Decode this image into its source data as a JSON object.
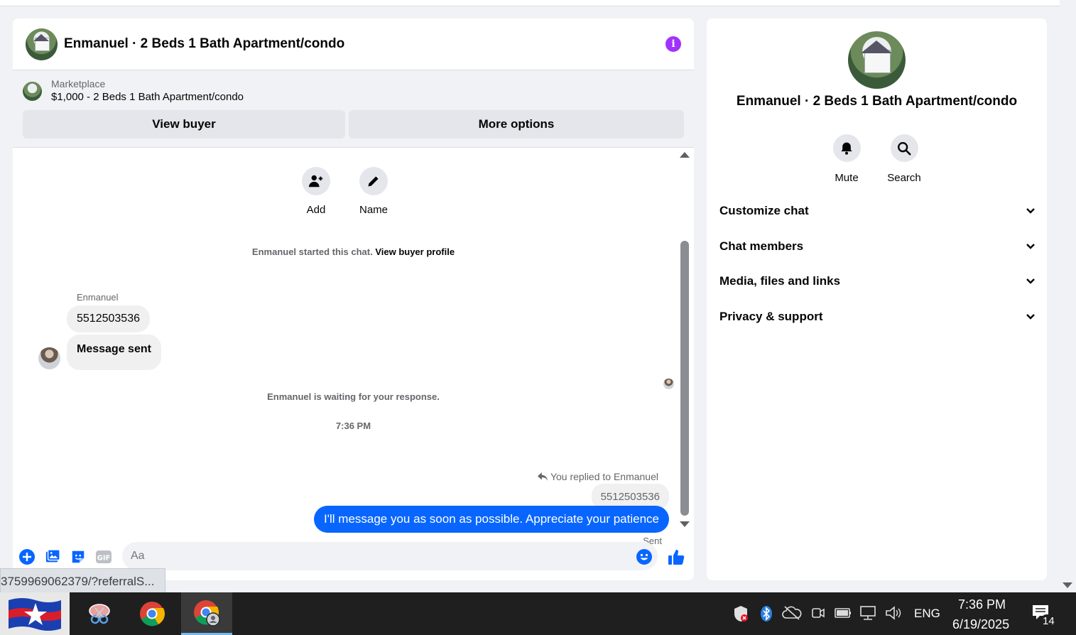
{
  "chat": {
    "header_title": "Enmanuel · 2 Beds 1 Bath Apartment/condo",
    "marketplace_label": "Marketplace",
    "listing": "$1,000 - 2 Beds 1 Bath Apartment/condo",
    "view_buyer": "View buyer",
    "more_options": "More options",
    "actions": [
      {
        "label": "Add",
        "icon": "add-person-icon"
      },
      {
        "label": "Name",
        "icon": "pencil-icon"
      }
    ],
    "started_text": "Enmanuel started this chat.",
    "view_buyer_profile": "View buyer profile",
    "sender": "Enmanuel",
    "incoming": [
      "5512503536",
      "Message sent"
    ],
    "waiting_text": "Enmanuel is waiting for your response.",
    "time": "7:36 PM",
    "replied_to": "You replied to Enmanuel",
    "quoted": "5512503536",
    "outgoing": "I'll message you as soon as possible. Appreciate your patience",
    "sent_status": "Sent",
    "composer_placeholder": "Aa"
  },
  "info_panel": {
    "title": "Enmanuel · 2 Beds 1 Bath Apartment/condo",
    "actions": [
      {
        "label": "Mute",
        "icon": "bell-icon"
      },
      {
        "label": "Search",
        "icon": "search-icon"
      }
    ],
    "sections": [
      "Customize chat",
      "Chat members",
      "Media, files and links",
      "Privacy & support"
    ]
  },
  "status_url": "3759969062379/?referralS...",
  "taskbar": {
    "language": "ENG",
    "time": "7:36 PM",
    "date": "6/19/2025",
    "notifications": "14"
  },
  "colors": {
    "accent": "#0866ff",
    "info": "#a033ff"
  }
}
